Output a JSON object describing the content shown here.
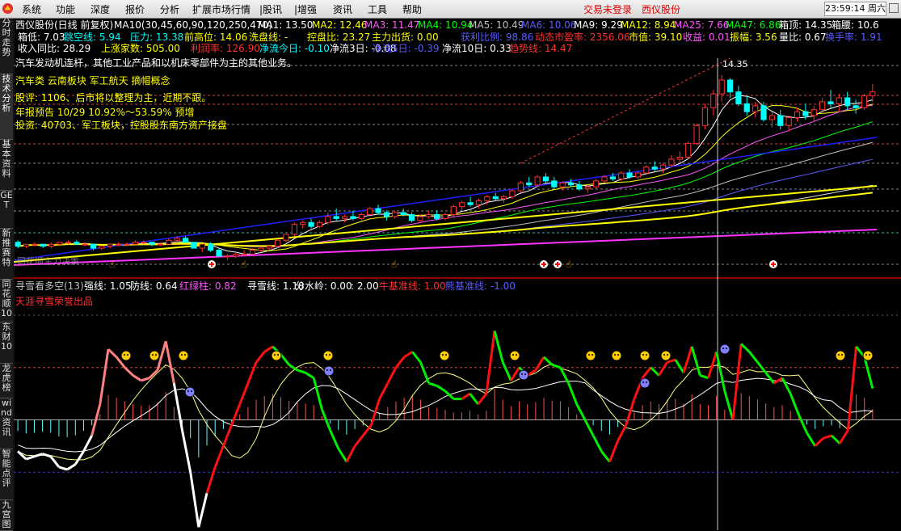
{
  "menubar": {
    "items": [
      "系统",
      "功能",
      "深度",
      "报价",
      "分析",
      "扩展市场行情",
      "|股讯",
      "|增强",
      "资讯",
      "工具",
      "帮助"
    ],
    "login_status": "交易未登录",
    "stock_name_top": "西仪股份",
    "clock": "23:59:14 周六"
  },
  "side_tabs": [
    {
      "label": "分时走势",
      "active": false
    },
    {
      "label": "技术分析",
      "active": true
    },
    {
      "label": "基本资料",
      "active": false
    },
    {
      "label": "GET",
      "active": false
    },
    {
      "label": "新推赛特",
      "active": false
    },
    {
      "label": "同花顺10",
      "active": false
    },
    {
      "label": "东财10",
      "active": false
    },
    {
      "label": "龙虎榜",
      "active": false
    },
    {
      "label": "wind资讯",
      "active": false
    },
    {
      "label": "智能点评",
      "active": false
    },
    {
      "label": "九宫图",
      "active": false
    }
  ],
  "header1": {
    "title": "西仪股份(日线 前复权)",
    "ma_params": "MA10(30,45,60,90,120,250,470)",
    "ma": [
      {
        "label": "MA1: 13.50",
        "color": "#ffffff"
      },
      {
        "label": "MA2: 12.46",
        "color": "#ffff00"
      },
      {
        "label": "MA3: 11.47",
        "color": "#ff55ff"
      },
      {
        "label": "MA4: 10.94",
        "color": "#00ff00"
      },
      {
        "label": "MA5: 10.49",
        "color": "#c0c0c0"
      },
      {
        "label": "MA6: 10.06",
        "color": "#5a5aff"
      },
      {
        "label": "MA9: 9.29",
        "color": "#ffffff"
      },
      {
        "label": "MA12: 8.94",
        "color": "#ffff00"
      },
      {
        "label": "MA25: 7.66",
        "color": "#ff55ff"
      },
      {
        "label": "MA47: 6.86",
        "color": "#00ff00"
      }
    ],
    "box_top": "箱顶: 14.35",
    "box_mid": "箱腰: 10.6"
  },
  "header2": [
    {
      "label": "箱低: 7.03",
      "color": "#ffffff"
    },
    {
      "label": "跳空线: 5.94",
      "color": "#00ffff"
    },
    {
      "label": "压力: 13.38",
      "color": "#00ffff"
    },
    {
      "label": "前高位: 14.06",
      "color": "#ffff00"
    },
    {
      "label": "洗盘线: -",
      "color": "#ffff00"
    },
    {
      "label": "控盘比: 23.27",
      "color": "#ffff00"
    },
    {
      "label": "主力出货: 0.00",
      "color": "#ffff00"
    },
    {
      "label": "获利比例: 98.86",
      "color": "#5a5aff"
    },
    {
      "label": "动态市盈率: 2356.06",
      "color": "#ff3030"
    },
    {
      "label": "市值: 39.10",
      "color": "#ffff00"
    },
    {
      "label": "收益: 0.01",
      "color": "#ff55ff"
    },
    {
      "label": "振幅: 3.56",
      "color": "#ffff00"
    },
    {
      "label": "量比: 0.67",
      "color": "#ffffff"
    },
    {
      "label": "换手率: 1.91",
      "color": "#5a5aff"
    }
  ],
  "header3": [
    {
      "label": "收入同比: 28.29",
      "color": "#ffffff"
    },
    {
      "label": "上涨家数: 505.00",
      "color": "#ffff00"
    },
    {
      "label": "利润率: 126.90",
      "color": "#ff3030"
    },
    {
      "label": "净流今日: -0.10",
      "color": "#00ffff"
    },
    {
      "label": "净流3日: -0.08",
      "color": "#ffffff"
    },
    {
      "label": "净流5日: -0.39",
      "color": "#5a5aff"
    },
    {
      "label": "净流10日: 0.33",
      "color": "#ffffff"
    },
    {
      "label": "趋势线: 14.47",
      "color": "#ff3030"
    }
  ],
  "info": {
    "desc": "汽车发动机连杆，其他工业产品和以机床零部件为主的其他业务。",
    "concepts": "汽车类 云南板块 军工航天 摘帽概念",
    "comment": "股评: 1106、后市将以整理为主，近期不跟。",
    "forecast": "年报预告 10/29 10.92%～53.59% 预增",
    "investment": "投资: 40703、军工板块，控股股东南方资产接盘",
    "price_label": "14.35",
    "watermark": "同花顺主力决策"
  },
  "sub_header": [
    {
      "label": "寻雪看多空(13)",
      "color": "#c0c0c0"
    },
    {
      "label": "强线: 1.05",
      "color": "#ffffff"
    },
    {
      "label": "防线: 0.64",
      "color": "#ffffff"
    },
    {
      "label": "红绿柱: 0.82",
      "color": "#ff55ff"
    },
    {
      "label": "寻雪线: 1.18",
      "color": "#ffffff"
    },
    {
      "label": "分水岭: 0.00",
      "color": "#ffffff"
    },
    {
      "label": ": 2.00",
      "color": "#ffffff"
    },
    {
      "label": "牛基准线: 1.00",
      "color": "#ff3030"
    },
    {
      "label": "熊基准线: -1.00",
      "color": "#5a5aff"
    }
  ],
  "sub_credit": "天涯寻雪荣誉出品",
  "chart_data": {
    "type": "candlestick",
    "price_axis": {
      "ylim": [
        4.5,
        15
      ]
    },
    "candles": [
      [
        5.9,
        6.0,
        5.6,
        5.7
      ],
      [
        5.7,
        5.8,
        5.6,
        5.8
      ],
      [
        5.8,
        5.9,
        5.7,
        5.8
      ],
      [
        5.8,
        5.8,
        5.6,
        5.7
      ],
      [
        5.7,
        5.9,
        5.6,
        5.8
      ],
      [
        5.8,
        5.9,
        5.7,
        5.9
      ],
      [
        5.9,
        6.0,
        5.8,
        5.9
      ],
      [
        5.9,
        6.0,
        5.8,
        5.8
      ],
      [
        5.8,
        5.9,
        5.7,
        5.8
      ],
      [
        5.8,
        5.8,
        5.5,
        5.6
      ],
      [
        5.6,
        5.7,
        5.5,
        5.7
      ],
      [
        5.7,
        5.8,
        5.6,
        5.8
      ],
      [
        5.8,
        5.9,
        5.7,
        5.8
      ],
      [
        5.8,
        5.9,
        5.7,
        5.8
      ],
      [
        5.8,
        6.0,
        5.8,
        5.9
      ],
      [
        5.9,
        6.0,
        5.8,
        5.9
      ],
      [
        5.9,
        5.9,
        5.7,
        5.8
      ],
      [
        5.8,
        5.9,
        5.7,
        5.8
      ],
      [
        5.8,
        6.1,
        5.8,
        6.0
      ],
      [
        6.0,
        6.2,
        5.9,
        6.1
      ],
      [
        6.1,
        6.2,
        5.9,
        5.9
      ],
      [
        5.9,
        5.9,
        5.6,
        5.6
      ],
      [
        5.6,
        5.8,
        5.4,
        5.8
      ],
      [
        5.8,
        5.9,
        5.4,
        5.5
      ],
      [
        5.5,
        5.6,
        5.2,
        5.2
      ],
      [
        5.2,
        5.3,
        5.0,
        5.2
      ],
      [
        5.2,
        5.4,
        5.1,
        5.3
      ],
      [
        5.3,
        5.5,
        5.2,
        5.3
      ],
      [
        5.3,
        5.6,
        5.3,
        5.5
      ],
      [
        5.5,
        5.7,
        5.4,
        5.6
      ],
      [
        5.6,
        5.8,
        5.5,
        5.7
      ],
      [
        5.7,
        6.0,
        5.6,
        6.0
      ],
      [
        6.0,
        6.3,
        5.9,
        6.3
      ],
      [
        6.3,
        6.9,
        6.2,
        6.8
      ],
      [
        6.8,
        7.0,
        6.6,
        6.9
      ],
      [
        6.9,
        7.1,
        6.6,
        6.7
      ],
      [
        6.7,
        7.0,
        6.6,
        6.9
      ],
      [
        6.9,
        7.4,
        6.8,
        7.2
      ],
      [
        7.2,
        7.6,
        7.0,
        7.1
      ],
      [
        7.1,
        7.3,
        6.9,
        7.2
      ],
      [
        7.2,
        7.5,
        7.0,
        7.1
      ],
      [
        7.1,
        7.4,
        7.0,
        7.3
      ],
      [
        7.3,
        7.7,
        7.2,
        7.6
      ],
      [
        7.6,
        7.8,
        7.3,
        7.4
      ],
      [
        7.4,
        7.5,
        7.0,
        7.2
      ],
      [
        7.2,
        7.5,
        7.1,
        7.4
      ],
      [
        7.4,
        7.6,
        7.2,
        7.3
      ],
      [
        7.3,
        7.4,
        6.9,
        7.0
      ],
      [
        7.0,
        7.3,
        6.9,
        7.2
      ],
      [
        7.2,
        7.5,
        7.1,
        7.3
      ],
      [
        7.3,
        7.5,
        7.0,
        7.1
      ],
      [
        7.1,
        7.4,
        7.0,
        7.3
      ],
      [
        7.3,
        7.8,
        7.2,
        7.7
      ],
      [
        7.7,
        8.0,
        7.5,
        7.9
      ],
      [
        7.9,
        8.2,
        7.7,
        7.8
      ],
      [
        7.8,
        8.1,
        7.6,
        8.0
      ],
      [
        8.0,
        8.3,
        7.8,
        8.2
      ],
      [
        8.2,
        8.4,
        8.0,
        8.1
      ],
      [
        8.1,
        8.3,
        7.9,
        8.2
      ],
      [
        8.2,
        8.6,
        8.1,
        8.5
      ],
      [
        8.5,
        9.0,
        8.4,
        8.9
      ],
      [
        8.9,
        9.2,
        8.7,
        8.8
      ],
      [
        8.8,
        9.3,
        8.7,
        9.2
      ],
      [
        9.2,
        9.4,
        8.9,
        9.0
      ],
      [
        9.0,
        9.2,
        8.6,
        8.7
      ],
      [
        8.7,
        9.0,
        8.5,
        8.9
      ],
      [
        8.9,
        9.1,
        8.7,
        8.8
      ],
      [
        8.8,
        9.0,
        8.5,
        8.6
      ],
      [
        8.6,
        8.8,
        8.4,
        8.7
      ],
      [
        8.7,
        9.1,
        8.6,
        9.0
      ],
      [
        9.0,
        9.3,
        8.9,
        9.2
      ],
      [
        9.2,
        9.4,
        9.0,
        9.1
      ],
      [
        9.1,
        9.5,
        9.0,
        9.4
      ],
      [
        9.4,
        9.6,
        9.1,
        9.2
      ],
      [
        9.2,
        9.5,
        9.1,
        9.4
      ],
      [
        9.4,
        9.8,
        9.3,
        9.7
      ],
      [
        9.7,
        10.0,
        9.5,
        9.6
      ],
      [
        9.6,
        9.9,
        9.4,
        9.8
      ],
      [
        9.8,
        10.3,
        9.7,
        10.1
      ],
      [
        10.1,
        10.5,
        9.9,
        10.2
      ],
      [
        10.2,
        11.0,
        10.1,
        10.9
      ],
      [
        10.9,
        11.9,
        10.8,
        11.8
      ],
      [
        11.8,
        12.9,
        11.6,
        12.7
      ],
      [
        12.7,
        13.6,
        12.3,
        13.4
      ],
      [
        13.4,
        14.35,
        13.0,
        14.1
      ],
      [
        14.1,
        14.2,
        13.2,
        13.5
      ],
      [
        13.5,
        13.8,
        12.8,
        12.9
      ],
      [
        12.9,
        13.3,
        12.3,
        12.5
      ],
      [
        12.5,
        13.0,
        12.2,
        12.8
      ],
      [
        12.8,
        13.0,
        12.0,
        12.1
      ],
      [
        12.1,
        12.5,
        11.7,
        12.3
      ],
      [
        12.3,
        12.6,
        11.6,
        11.8
      ],
      [
        11.8,
        12.3,
        11.5,
        12.2
      ],
      [
        12.2,
        12.7,
        12.0,
        12.5
      ],
      [
        12.5,
        12.9,
        12.1,
        12.3
      ],
      [
        12.3,
        12.8,
        12.0,
        12.6
      ],
      [
        12.6,
        13.2,
        12.4,
        13.0
      ],
      [
        13.0,
        13.6,
        12.7,
        12.9
      ],
      [
        12.9,
        13.4,
        12.5,
        13.2
      ],
      [
        13.2,
        13.5,
        12.6,
        12.8
      ],
      [
        12.8,
        13.1,
        12.4,
        12.7
      ],
      [
        12.7,
        13.4,
        12.6,
        13.3
      ],
      [
        13.3,
        13.9,
        13.0,
        13.5
      ]
    ],
    "indicator_axis": {
      "ylim": [
        -2.2,
        2.2
      ]
    },
    "indicator_line": [
      -0.6,
      -0.75,
      -0.7,
      -0.65,
      -0.7,
      -0.9,
      -0.95,
      -0.85,
      -0.6,
      -0.3,
      0.3,
      1.35,
      1.2,
      1.0,
      0.85,
      0.75,
      0.8,
      0.95,
      1.5,
      0.7,
      -0.2,
      -1.0,
      -2.05,
      -1.4,
      -0.9,
      -0.5,
      -0.1,
      0.3,
      0.7,
      1.1,
      1.3,
      1.4,
      1.25,
      1.05,
      0.95,
      0.9,
      0.8,
      0.2,
      -0.2,
      -0.55,
      -0.8,
      -0.5,
      -0.3,
      -0.1,
      0.4,
      0.7,
      1.0,
      1.2,
      1.3,
      1.1,
      0.7,
      0.65,
      0.55,
      0.4,
      0.4,
      0.5,
      0.3,
      0.5,
      1.7,
      1.1,
      0.75,
      1.0,
      0.85,
      0.95,
      1.2,
      1.05,
      1.0,
      0.7,
      0.3,
      0.0,
      -0.3,
      -0.6,
      -0.8,
      -0.4,
      -0.1,
      0.4,
      0.8,
      1.0,
      0.85,
      1.1,
      1.15,
      0.9,
      1.4,
      0.85,
      0.8,
      1.3,
      0.55,
      0.0,
      1.45,
      1.3,
      1.1,
      0.9,
      0.7,
      0.8,
      0.5,
      0.1,
      -0.25,
      -0.5,
      -0.35,
      -0.3,
      -0.45,
      -0.2,
      1.4,
      1.2,
      0.6
    ]
  }
}
